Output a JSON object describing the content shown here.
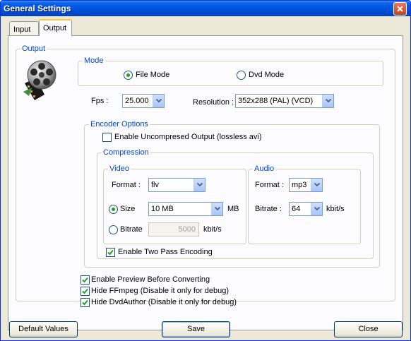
{
  "window": {
    "title": "General Settings"
  },
  "tabs": [
    {
      "label": "Input",
      "active": false
    },
    {
      "label": "Output",
      "active": true
    }
  ],
  "output_group": {
    "legend": "Output",
    "icon": "film-reel-icon"
  },
  "mode": {
    "legend": "Mode",
    "options": [
      {
        "label": "File Mode",
        "selected": true
      },
      {
        "label": "Dvd Mode",
        "selected": false
      }
    ]
  },
  "fps": {
    "label": "Fps :",
    "value": "25.000"
  },
  "resolution": {
    "label": "Resolution :",
    "value": "352x288 (PAL) (VCD)"
  },
  "encoder": {
    "legend": "Encoder Options",
    "uncompressed": {
      "label": "Enable Uncompresed Output (lossless avi)",
      "checked": false
    }
  },
  "compression": {
    "legend": "Compression",
    "video": {
      "legend": "Video",
      "format_label": "Format :",
      "format_value": "flv",
      "size_option": {
        "label": "Size",
        "selected": true
      },
      "size_value": "10 MB",
      "size_unit": "MB",
      "bitrate_option": {
        "label": "Bitrate",
        "selected": false
      },
      "bitrate_value": "5000",
      "bitrate_unit": "kbit/s"
    },
    "audio": {
      "legend": "Audio",
      "format_label": "Format :",
      "format_value": "mp3",
      "bitrate_label": "Bitrate :",
      "bitrate_value": "64",
      "bitrate_unit": "kbit/s"
    },
    "two_pass": {
      "label": "Enable Two Pass Encoding",
      "checked": true
    }
  },
  "options": [
    {
      "label": "Enable Preview Before Converting",
      "checked": true
    },
    {
      "label": "Hide FFmpeg (Disable it only for debug)",
      "checked": true
    },
    {
      "label": "Hide DvdAuthor (Disable it only for debug)",
      "checked": true
    }
  ],
  "buttons": {
    "default_values": "Default Values",
    "save": "Save",
    "close": "Close"
  },
  "colors": {
    "title_bar": "#0054e3",
    "group_legend": "#0046d5",
    "radio_dot": "#21a121",
    "close_button": "#c4441e"
  }
}
